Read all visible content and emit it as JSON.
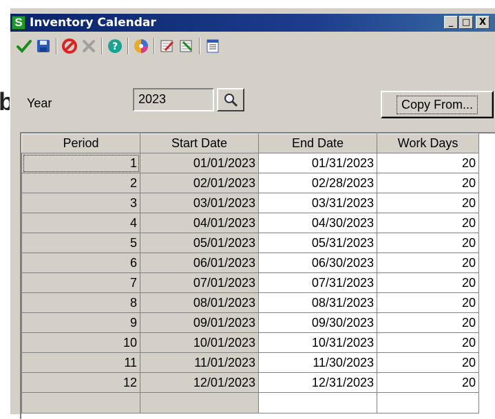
{
  "stray_letter": "b",
  "window": {
    "title": "Inventory Calendar",
    "app_icon_letter": "S",
    "min_glyph": "_",
    "max_glyph": "□",
    "close_glyph": "X"
  },
  "toolbar": {
    "icons": [
      "accept-check-icon",
      "save-disk-icon",
      "cancel-circle-icon",
      "delete-x-icon",
      "help-icon",
      "color-palette-icon",
      "grid-import-icon",
      "grid-export-icon",
      "calendar-list-icon"
    ]
  },
  "form": {
    "year_label": "Year",
    "year_value": "2023",
    "copy_from_label": "Copy From..."
  },
  "grid": {
    "headers": [
      "Period",
      "Start Date",
      "End Date",
      "Work Days"
    ],
    "rows": [
      {
        "period": "1",
        "start": "01/01/2023",
        "end": "01/31/2023",
        "days": "20"
      },
      {
        "period": "2",
        "start": "02/01/2023",
        "end": "02/28/2023",
        "days": "20"
      },
      {
        "period": "3",
        "start": "03/01/2023",
        "end": "03/31/2023",
        "days": "20"
      },
      {
        "period": "4",
        "start": "04/01/2023",
        "end": "04/30/2023",
        "days": "20"
      },
      {
        "period": "5",
        "start": "05/01/2023",
        "end": "05/31/2023",
        "days": "20"
      },
      {
        "period": "6",
        "start": "06/01/2023",
        "end": "06/30/2023",
        "days": "20"
      },
      {
        "period": "7",
        "start": "07/01/2023",
        "end": "07/31/2023",
        "days": "20"
      },
      {
        "period": "8",
        "start": "08/01/2023",
        "end": "08/31/2023",
        "days": "20"
      },
      {
        "period": "9",
        "start": "09/01/2023",
        "end": "09/30/2023",
        "days": "20"
      },
      {
        "period": "10",
        "start": "10/01/2023",
        "end": "10/31/2023",
        "days": "20"
      },
      {
        "period": "11",
        "start": "11/01/2023",
        "end": "11/30/2023",
        "days": "20"
      },
      {
        "period": "12",
        "start": "12/01/2023",
        "end": "12/31/2023",
        "days": "20"
      }
    ]
  },
  "colors": {
    "title_bar": "#0a246a",
    "window_face": "#d4d0c8",
    "app_icon": "#1f9a2a"
  }
}
